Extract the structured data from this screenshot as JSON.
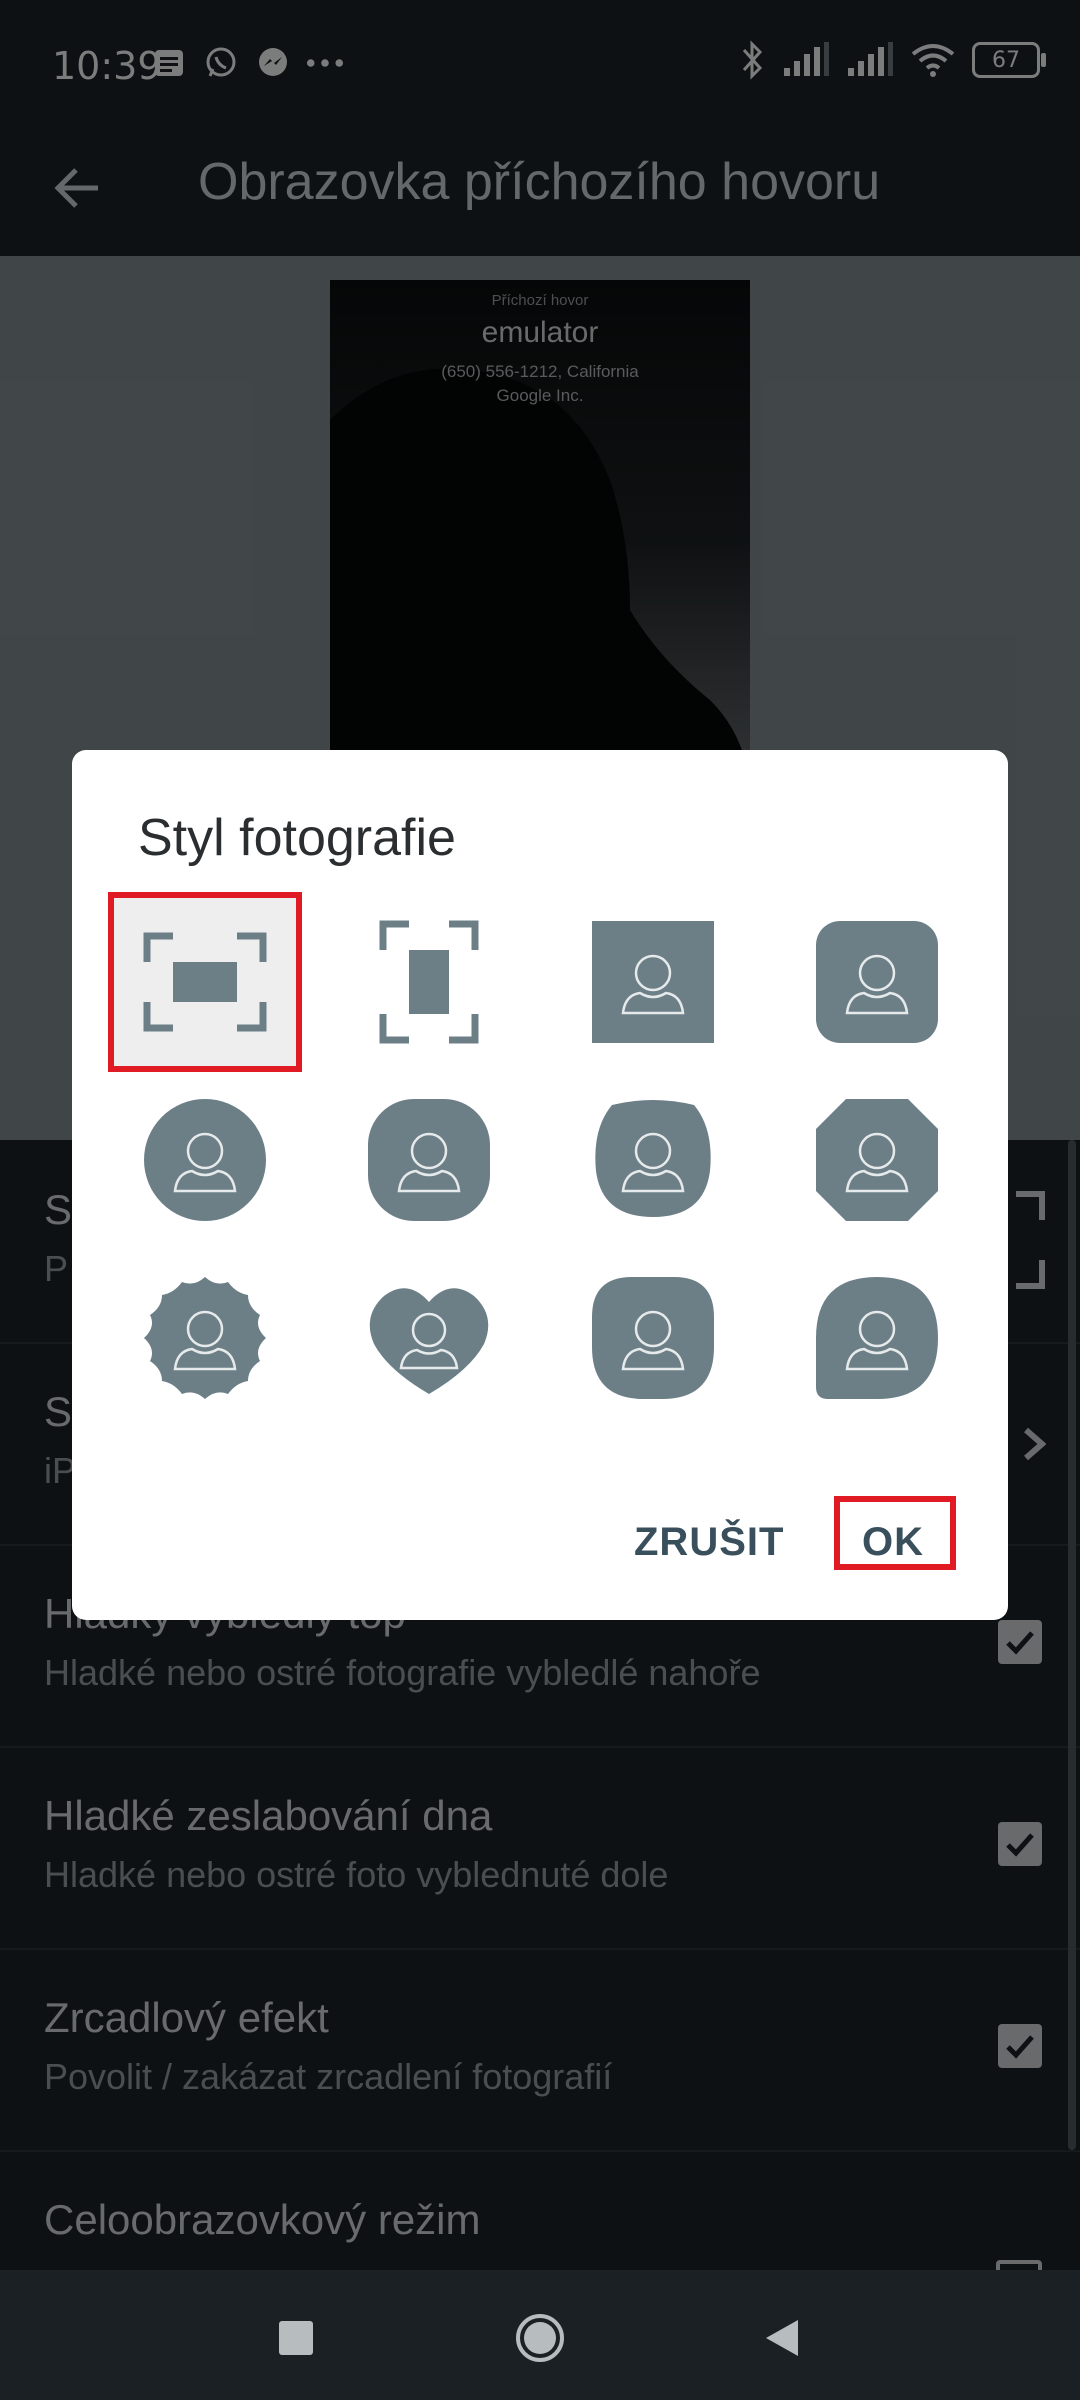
{
  "status_bar": {
    "time": "10:39",
    "battery_percent": "67"
  },
  "app_bar": {
    "title": "Obrazovka příchozího hovoru"
  },
  "preview": {
    "label": "Příchozí hovor",
    "caller_name": "emulator",
    "caller_number": "(650) 556-1212, California",
    "caller_org": "Google Inc."
  },
  "settings_list": [
    {
      "title": "St",
      "subtitle": "P",
      "control": "frame-icon"
    },
    {
      "title": "St",
      "subtitle": "iP",
      "control": "dropdown-icon"
    },
    {
      "title": "Hladký vybledlý top",
      "subtitle": "Hladké nebo ostré fotografie vybledlé nahoře",
      "checked": true
    },
    {
      "title": "Hladké zeslabování dna",
      "subtitle": "Hladké nebo ostré foto vyblednuté dole",
      "checked": true
    },
    {
      "title": "Zrcadlový efekt",
      "subtitle": "Povolit / zakázat zrcadlení fotografií",
      "checked": true
    },
    {
      "title": "Celoobrazovkový režim",
      "subtitle": "",
      "checked": false
    }
  ],
  "dialog": {
    "title": "Styl fotografie",
    "options": [
      {
        "icon": "fullscreen-horizontal-icon",
        "selected": true
      },
      {
        "icon": "fullscreen-vertical-icon",
        "selected": false
      },
      {
        "icon": "square-avatar-icon",
        "selected": false
      },
      {
        "icon": "rounded-square-avatar-icon",
        "selected": false
      },
      {
        "icon": "circle-avatar-icon",
        "selected": false
      },
      {
        "icon": "squircle-avatar-icon",
        "selected": false
      },
      {
        "icon": "pebble-avatar-icon",
        "selected": false
      },
      {
        "icon": "octagon-avatar-icon",
        "selected": false
      },
      {
        "icon": "scalloped-avatar-icon",
        "selected": false
      },
      {
        "icon": "heart-avatar-icon",
        "selected": false
      },
      {
        "icon": "blob-avatar-icon",
        "selected": false
      },
      {
        "icon": "leaf-avatar-icon",
        "selected": false
      }
    ],
    "cancel_label": "ZRUŠIT",
    "ok_label": "OK"
  },
  "colors": {
    "shape_fill": "#6c7f87",
    "highlight": "#e01b24",
    "dialog_button_text": "#3a4f5c"
  }
}
